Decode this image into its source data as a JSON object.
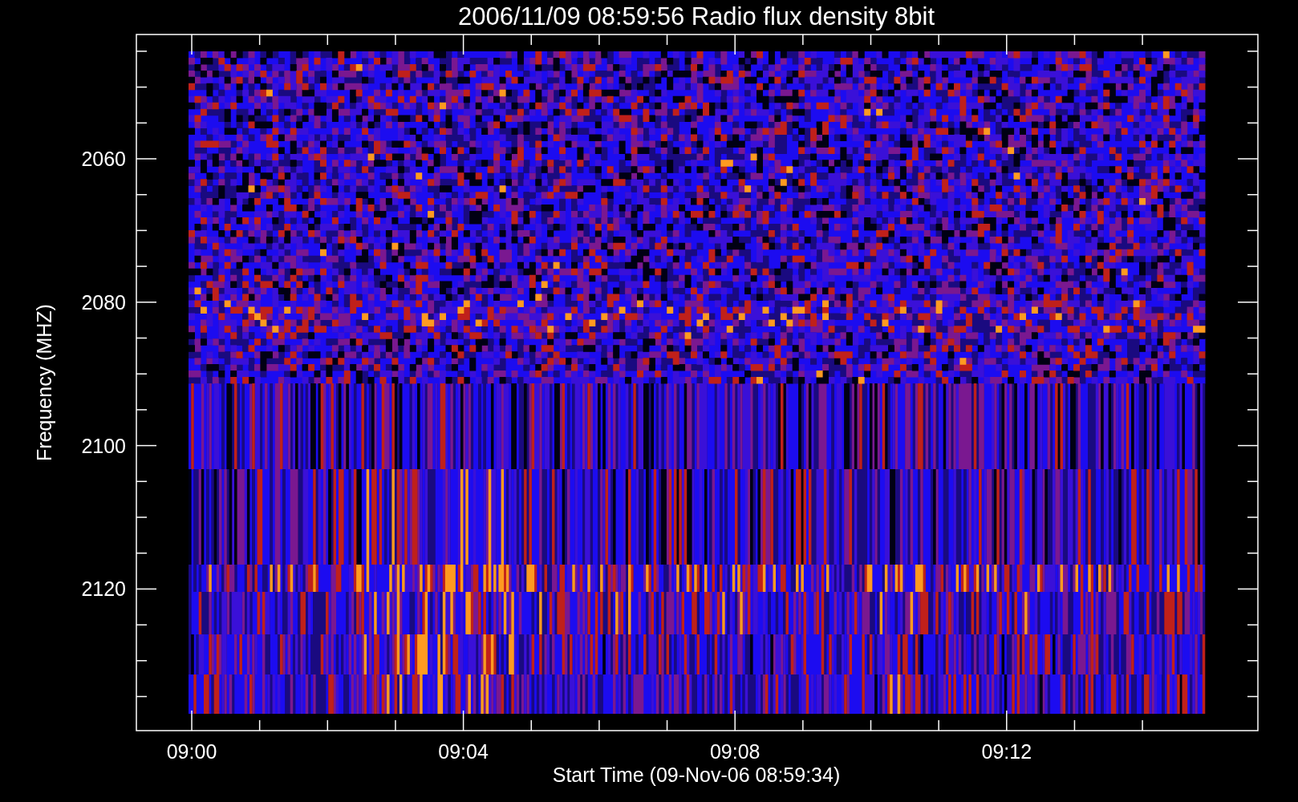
{
  "title": "2006/11/09 08:59:56 Radio flux density 8bit",
  "y_axis": {
    "label": "Frequency (MHZ)",
    "ticks": [
      "2060",
      "2080",
      "2100",
      "2120"
    ]
  },
  "x_axis": {
    "label": "Start Time (09-Nov-06 08:59:34)",
    "ticks": [
      "09:00",
      "09:04",
      "09:08",
      "09:12"
    ]
  }
}
